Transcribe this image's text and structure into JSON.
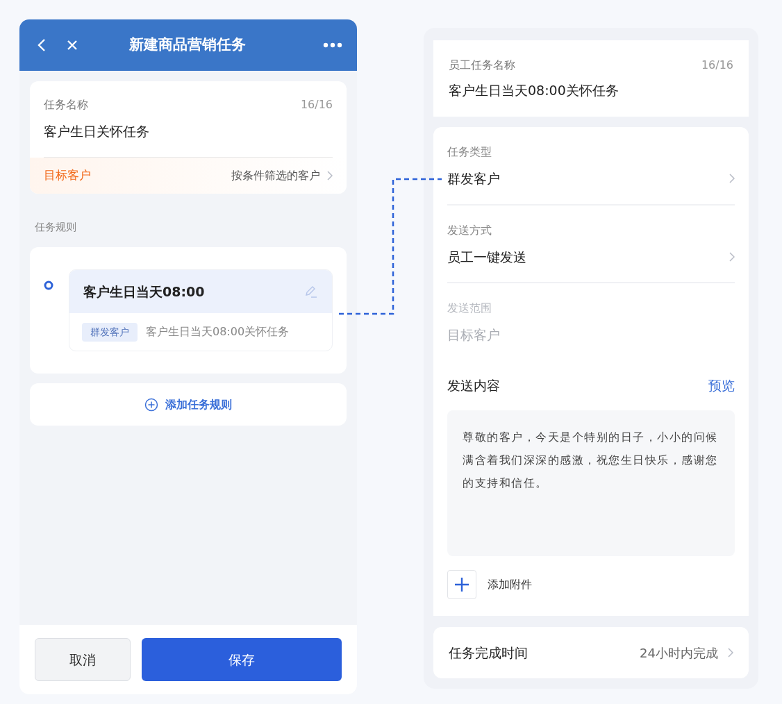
{
  "header": {
    "title": "新建商品营销任务"
  },
  "task_name": {
    "label": "任务名称",
    "counter": "16/16",
    "value": "客户生日关怀任务"
  },
  "target": {
    "label": "目标客户",
    "value": "按条件筛选的客户"
  },
  "rules_section": {
    "title": "任务规则",
    "add_button": "添加任务规则",
    "rules": [
      {
        "title": "客户生日当天08:00",
        "tag": "群发客户",
        "description": "客户生日当天08:00关怀任务"
      }
    ]
  },
  "footer": {
    "buttons": [
      {
        "label": "取消",
        "kind": "secondary"
      },
      {
        "label": "保存",
        "kind": "primary"
      }
    ]
  },
  "detail": {
    "employee_task": {
      "label": "员工任务名称",
      "counter": "16/16",
      "value": "客户生日当天08:00关怀任务"
    },
    "fields": [
      {
        "label": "任务类型",
        "value": "群发客户",
        "disabled": false
      },
      {
        "label": "发送方式",
        "value": "员工一键发送",
        "disabled": false
      },
      {
        "label": "发送范围",
        "value": "目标客户",
        "disabled": true
      }
    ],
    "content": {
      "title": "发送内容",
      "preview": "预览",
      "message": "尊敬的客户，今天是个特别的日子，小小的问候满含着我们深深的感激，祝您生日快乐，感谢您的支持和信任。",
      "attach": "添加附件"
    },
    "completion": {
      "label": "任务完成时间",
      "value": "24小时内完成"
    }
  }
}
